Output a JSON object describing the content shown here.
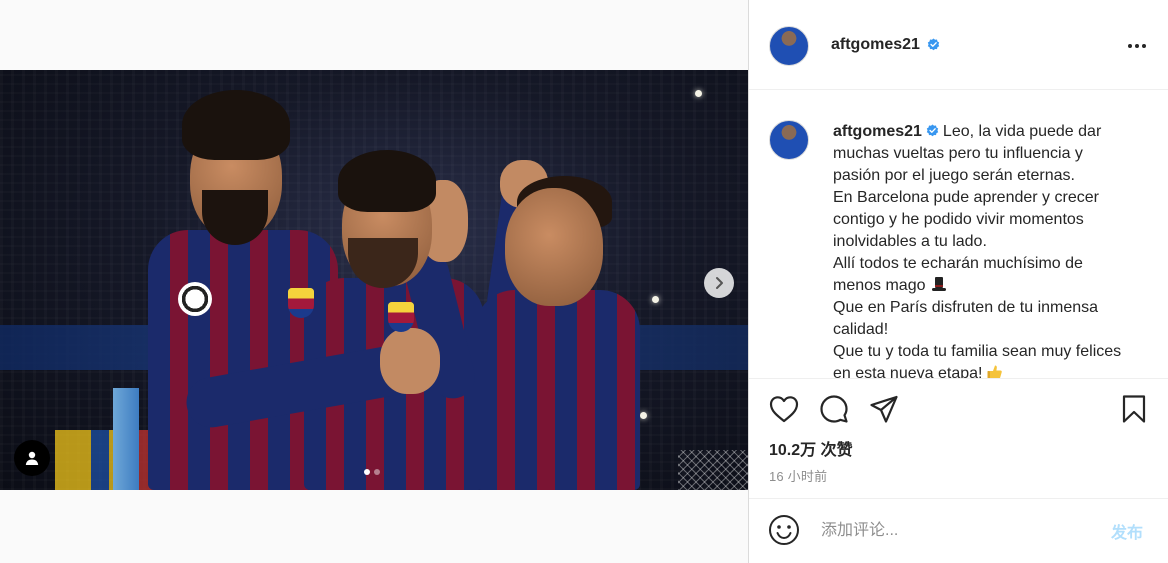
{
  "post": {
    "author": {
      "username": "aftgomes21",
      "verified": true,
      "avatar_icon": "profile-avatar"
    },
    "header": {
      "more_icon": "more-options-icon"
    },
    "media": {
      "carousel": {
        "slide_count": 2,
        "active_slide": 1
      },
      "next_icon": "chevron-right-icon",
      "user_tag_icon": "user-tag-icon"
    },
    "caption": {
      "username": "aftgomes21",
      "text_lines": [
        "Leo, la vida puede dar muchas vueltas pero tu influencia y pasión por el juego serán eternas.",
        "En Barcelona pude aprender y crecer contigo y he podido vivir momentos inolvidables a tu lado.",
        "Allí todos te echarán muchísimo de menos mago",
        "Que en París disfruten de tu inmensa calidad!",
        "Que tu y toda tu familia sean muy felices en esta nueva etapa!"
      ],
      "emoji_1": "top-hat-emoji",
      "emoji_2": "thumbs-up-emoji"
    },
    "actions": {
      "like_icon": "heart-icon",
      "comment_icon": "comment-icon",
      "share_icon": "send-icon",
      "save_icon": "bookmark-icon"
    },
    "likes": "10.2万 次赞",
    "timestamp": "16 小时前",
    "comment_box": {
      "emoji_icon": "emoji-smiley-icon",
      "placeholder": "添加评论...",
      "value": "",
      "post_label": "发布"
    },
    "colors": {
      "verified_badge": "#3897f0",
      "post_button_disabled": "#b2dffc",
      "secondary_text": "#8e8e8e",
      "primary_text": "#262626"
    }
  }
}
